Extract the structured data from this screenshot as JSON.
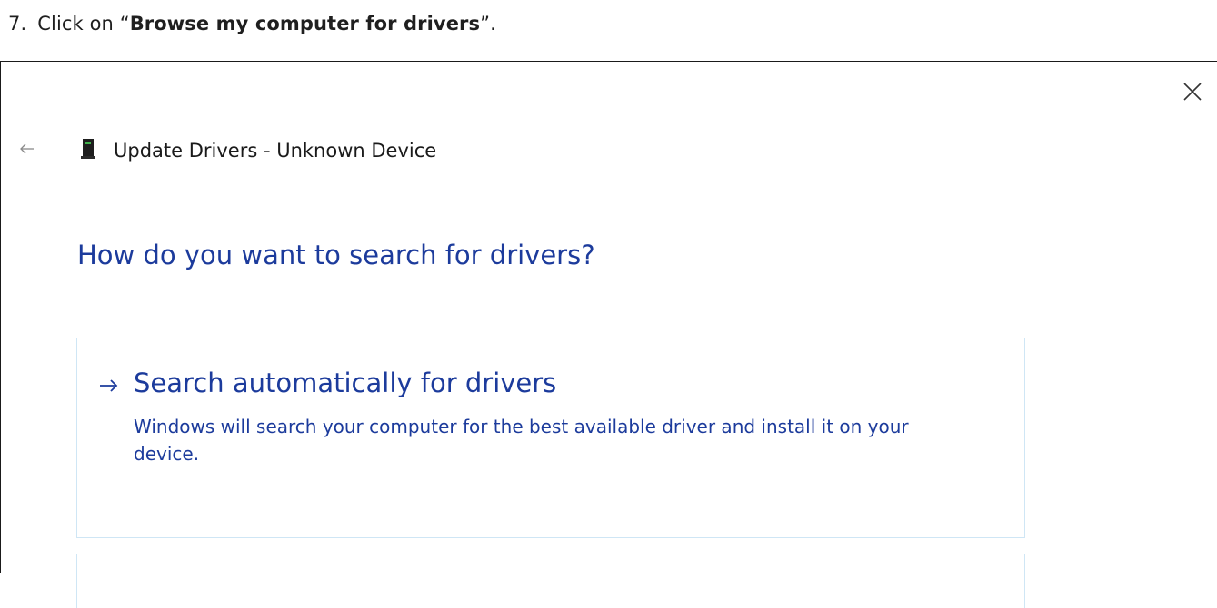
{
  "instruction": {
    "step": "7.",
    "prefix": "Click on “",
    "bold": "Browse my computer for drivers",
    "suffix": "”."
  },
  "dialog": {
    "title": "Update Drivers - Unknown Device",
    "heading": "How do you want to search for drivers?",
    "options": [
      {
        "title": "Search automatically for drivers",
        "description": "Windows will search your computer for the best available driver and install it on your device."
      }
    ]
  },
  "icons": {
    "close": "close-icon",
    "back": "back-arrow-icon",
    "device": "device-icon",
    "option_arrow": "arrow-right-icon"
  },
  "colors": {
    "heading": "#1c3b9c",
    "card_border": "#cfe6f5",
    "text": "#1a1a1a"
  }
}
